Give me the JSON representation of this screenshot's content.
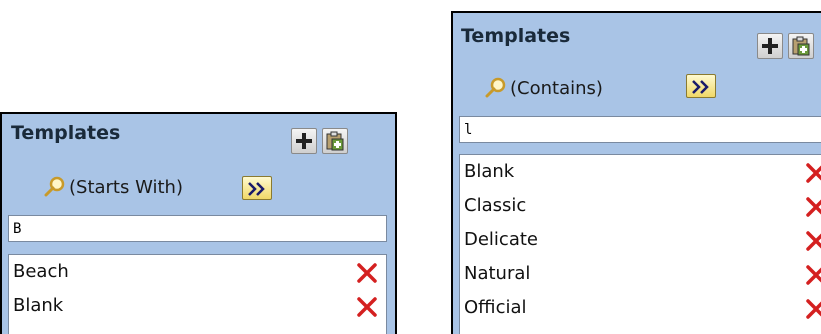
{
  "left_panel": {
    "title": "Templates",
    "filter_mode": "(Starts With)",
    "search_value": "B",
    "items": [
      {
        "label": "Beach"
      },
      {
        "label": "Blank"
      }
    ]
  },
  "right_panel": {
    "title": "Templates",
    "filter_mode": "(Contains)",
    "search_value": "l",
    "items": [
      {
        "label": "Blank"
      },
      {
        "label": "Classic"
      },
      {
        "label": "Delicate"
      },
      {
        "label": "Natural"
      },
      {
        "label": "Official"
      }
    ]
  },
  "colors": {
    "panel_bg": "#a9c4e6",
    "delete_red": "#d42020",
    "go_button": "#f0d868"
  },
  "icons": {
    "add": "plus-icon",
    "paste": "clipboard-paste-icon",
    "search": "magnifier-icon",
    "go": "double-chevron-right-icon",
    "delete": "red-x-delete-icon"
  }
}
